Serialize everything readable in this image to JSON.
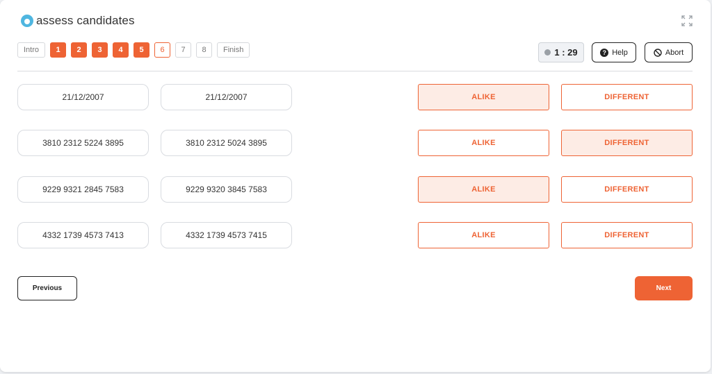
{
  "app": {
    "logo_text": "assess candidates"
  },
  "steps": [
    {
      "label": "Intro",
      "state": "plain"
    },
    {
      "label": "1",
      "state": "filled"
    },
    {
      "label": "2",
      "state": "filled"
    },
    {
      "label": "3",
      "state": "filled"
    },
    {
      "label": "4",
      "state": "filled"
    },
    {
      "label": "5",
      "state": "filled"
    },
    {
      "label": "6",
      "state": "current"
    },
    {
      "label": "7",
      "state": "plain"
    },
    {
      "label": "8",
      "state": "plain"
    },
    {
      "label": "Finish",
      "state": "plain"
    }
  ],
  "timer": {
    "text": "1 : 29"
  },
  "header": {
    "help_label": "Help",
    "abort_label": "Abort"
  },
  "rows": [
    {
      "a": "21/12/2007",
      "b": "21/12/2007",
      "selected": "alike"
    },
    {
      "a": "3810 2312 5224 3895",
      "b": "3810 2312 5024 3895",
      "selected": "different"
    },
    {
      "a": "9229 9321 2845 7583",
      "b": "9229 9320 3845 7583",
      "selected": "alike"
    },
    {
      "a": "4332 1739 4573 7413",
      "b": "4332 1739 4573 7415",
      "selected": ""
    }
  ],
  "choices": {
    "alike_label": "ALIKE",
    "different_label": "DIFFERENT"
  },
  "footer": {
    "previous_label": "Previous",
    "next_label": "Next"
  },
  "colors": {
    "accent": "#ee6334",
    "accent_light": "#fdece5",
    "logo": "#4fb6e0"
  }
}
